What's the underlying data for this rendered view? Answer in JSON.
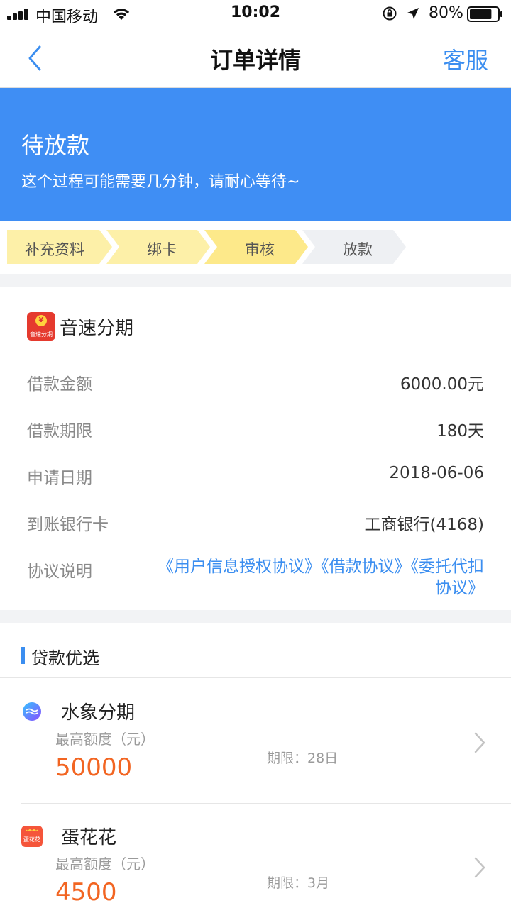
{
  "status_bar": {
    "carrier": "中国移动",
    "time": "10:02",
    "battery_percent": "80%",
    "battery_level": 0.8
  },
  "nav": {
    "title": "订单详情",
    "service": "客服"
  },
  "banner": {
    "title": "待放款",
    "subtitle": "这个过程可能需要几分钟，请耐心等待~"
  },
  "steps": [
    {
      "label": "补充资料",
      "state": "done"
    },
    {
      "label": "绑卡",
      "state": "done"
    },
    {
      "label": "审核",
      "state": "current"
    },
    {
      "label": "放款",
      "state": "pending"
    }
  ],
  "order": {
    "lender_name": "音速分期",
    "lender_logo_text": "音速分期",
    "rows": [
      {
        "label": "借款金额",
        "value": "6000.00元"
      },
      {
        "label": "借款期限",
        "value": "180天"
      },
      {
        "label": "申请日期",
        "value": "2018-06-06"
      },
      {
        "label": "到账银行卡",
        "value": "工商银行(4168)"
      }
    ],
    "agreement_label": "协议说明",
    "agreements": [
      "《用户信息授权协议》",
      "《借款协议》",
      "《委托代扣协议》"
    ]
  },
  "recommend": {
    "title": "贷款优选",
    "products": [
      {
        "name": "水象分期",
        "limit_label": "最高额度（元）",
        "limit": "50000",
        "term": "期限：28日"
      },
      {
        "name": "蛋花花",
        "limit_label": "最高额度（元）",
        "limit": "4500",
        "term": "期限：3月",
        "logo_text": "蛋花花"
      }
    ]
  },
  "colors": {
    "accent": "#3b8ef0",
    "banner": "#3f8ef4",
    "step_active": "#fdf0a8",
    "step_current": "#fde98a",
    "step_pending": "#eef0f3",
    "amount": "#f26522"
  }
}
